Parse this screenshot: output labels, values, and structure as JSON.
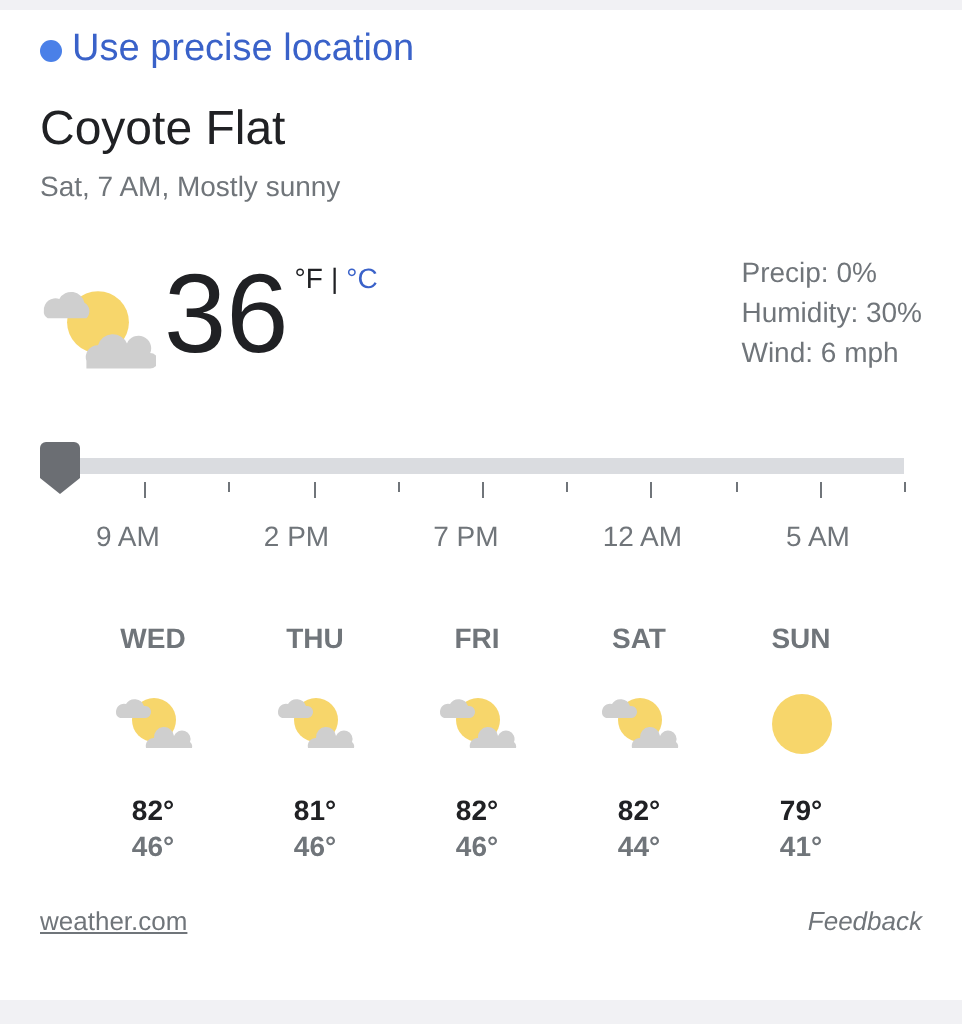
{
  "location_link": {
    "label": "Use precise location"
  },
  "place": "Coyote Flat",
  "subtitle": "Sat, 7 AM, Mostly sunny",
  "current": {
    "kind": "partly_cloudy",
    "temperature": "36",
    "separator": "|",
    "units": [
      {
        "label": "°F",
        "selected": true
      },
      {
        "label": "°C",
        "selected": false
      }
    ],
    "details": [
      "Precip: 0%",
      "Humidity: 30%",
      "Wind: 6 mph"
    ]
  },
  "timeline": {
    "level": 0,
    "labels": [
      "9 AM",
      "2 PM",
      "7 PM",
      "12 AM",
      "5 AM"
    ]
  },
  "days": [
    {
      "day": "WED",
      "kind": "partly_cloudy",
      "high": "82°",
      "low": "46°"
    },
    {
      "day": "THU",
      "kind": "partly_cloudy",
      "high": "81°",
      "low": "46°"
    },
    {
      "day": "FRI",
      "kind": "partly_cloudy",
      "high": "82°",
      "low": "46°"
    },
    {
      "day": "SAT",
      "kind": "partly_cloudy",
      "high": "82°",
      "low": "44°"
    },
    {
      "day": "SUN",
      "kind": "sunny",
      "high": "79°",
      "low": "41°"
    }
  ],
  "footer": {
    "source": "weather.com",
    "feedback": "Feedback"
  }
}
